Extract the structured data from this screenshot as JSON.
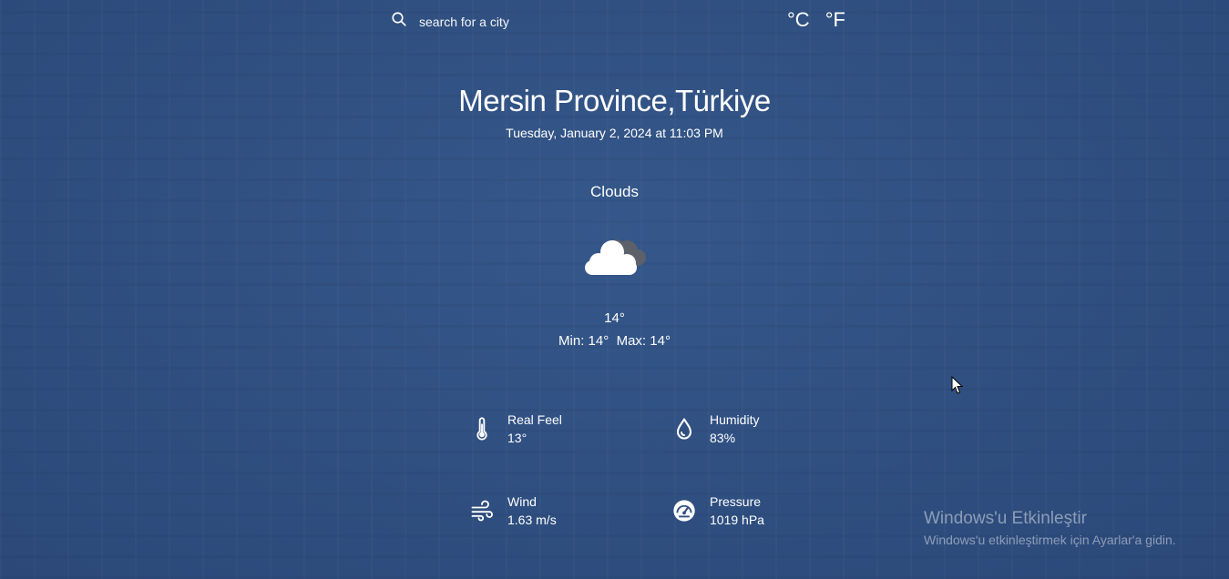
{
  "search": {
    "placeholder": "search for a city"
  },
  "units": {
    "celsius": "°C",
    "fahrenheit": "°F"
  },
  "location": {
    "city": "Mersin Province,Türkiye",
    "datetime": "Tuesday, January 2, 2024 at 11:03 PM"
  },
  "weather": {
    "condition": "Clouds",
    "icon": "cloud-icon",
    "temperature": "14°",
    "min": "Min: 14°",
    "max": "Max: 14°"
  },
  "details": {
    "real_feel": {
      "label": "Real Feel",
      "value": "13°",
      "icon": "thermometer-icon"
    },
    "humidity": {
      "label": "Humidity",
      "value": "83%",
      "icon": "droplet-icon"
    },
    "wind": {
      "label": "Wind",
      "value": "1.63 m/s",
      "icon": "wind-icon"
    },
    "pressure": {
      "label": "Pressure",
      "value": "1019 hPa",
      "icon": "gauge-icon"
    }
  },
  "watermark": {
    "title": "Windows'u Etkinleştir",
    "subtitle": "Windows'u etkinleştirmek için Ayarlar'a gidin."
  },
  "colors": {
    "background": "#2f4f80",
    "text": "#ffffff"
  }
}
